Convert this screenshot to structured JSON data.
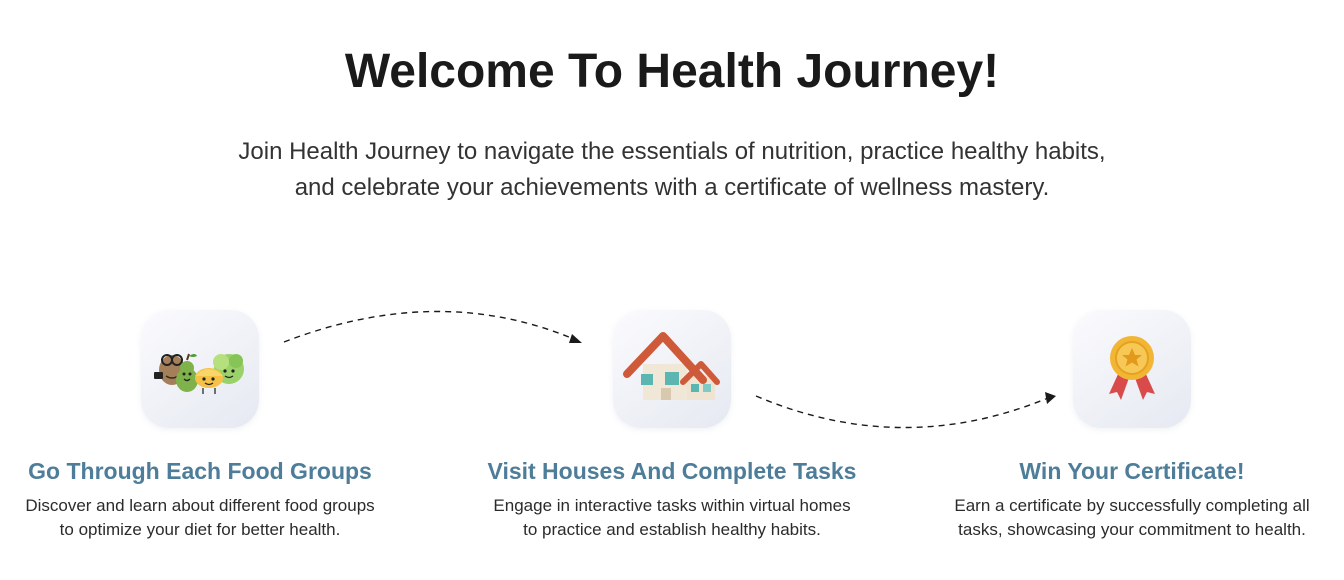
{
  "header": {
    "title": "Welcome To Health Journey!",
    "subtitle_line1": "Join Health Journey to navigate the essentials of nutrition, practice healthy habits,",
    "subtitle_line2": "and celebrate your achievements with a certificate of wellness mastery."
  },
  "steps": [
    {
      "icon": "food-characters-icon",
      "title": "Go Through Each Food Groups",
      "desc_line1": "Discover and learn about different food groups",
      "desc_line2": "to optimize your diet for better health."
    },
    {
      "icon": "house-icon",
      "title": "Visit Houses And Complete Tasks",
      "desc_line1": "Engage in interactive tasks within virtual homes",
      "desc_line2": "to practice and establish healthy habits."
    },
    {
      "icon": "medal-icon",
      "title": "Win Your Certificate!",
      "desc_line1": "Earn a certificate by successfully completing all",
      "desc_line2": "tasks, showcasing your commitment to health."
    }
  ],
  "colors": {
    "title": "#1a1a1a",
    "step_title": "#4e7d9a",
    "body_text": "#2b2b2b"
  }
}
